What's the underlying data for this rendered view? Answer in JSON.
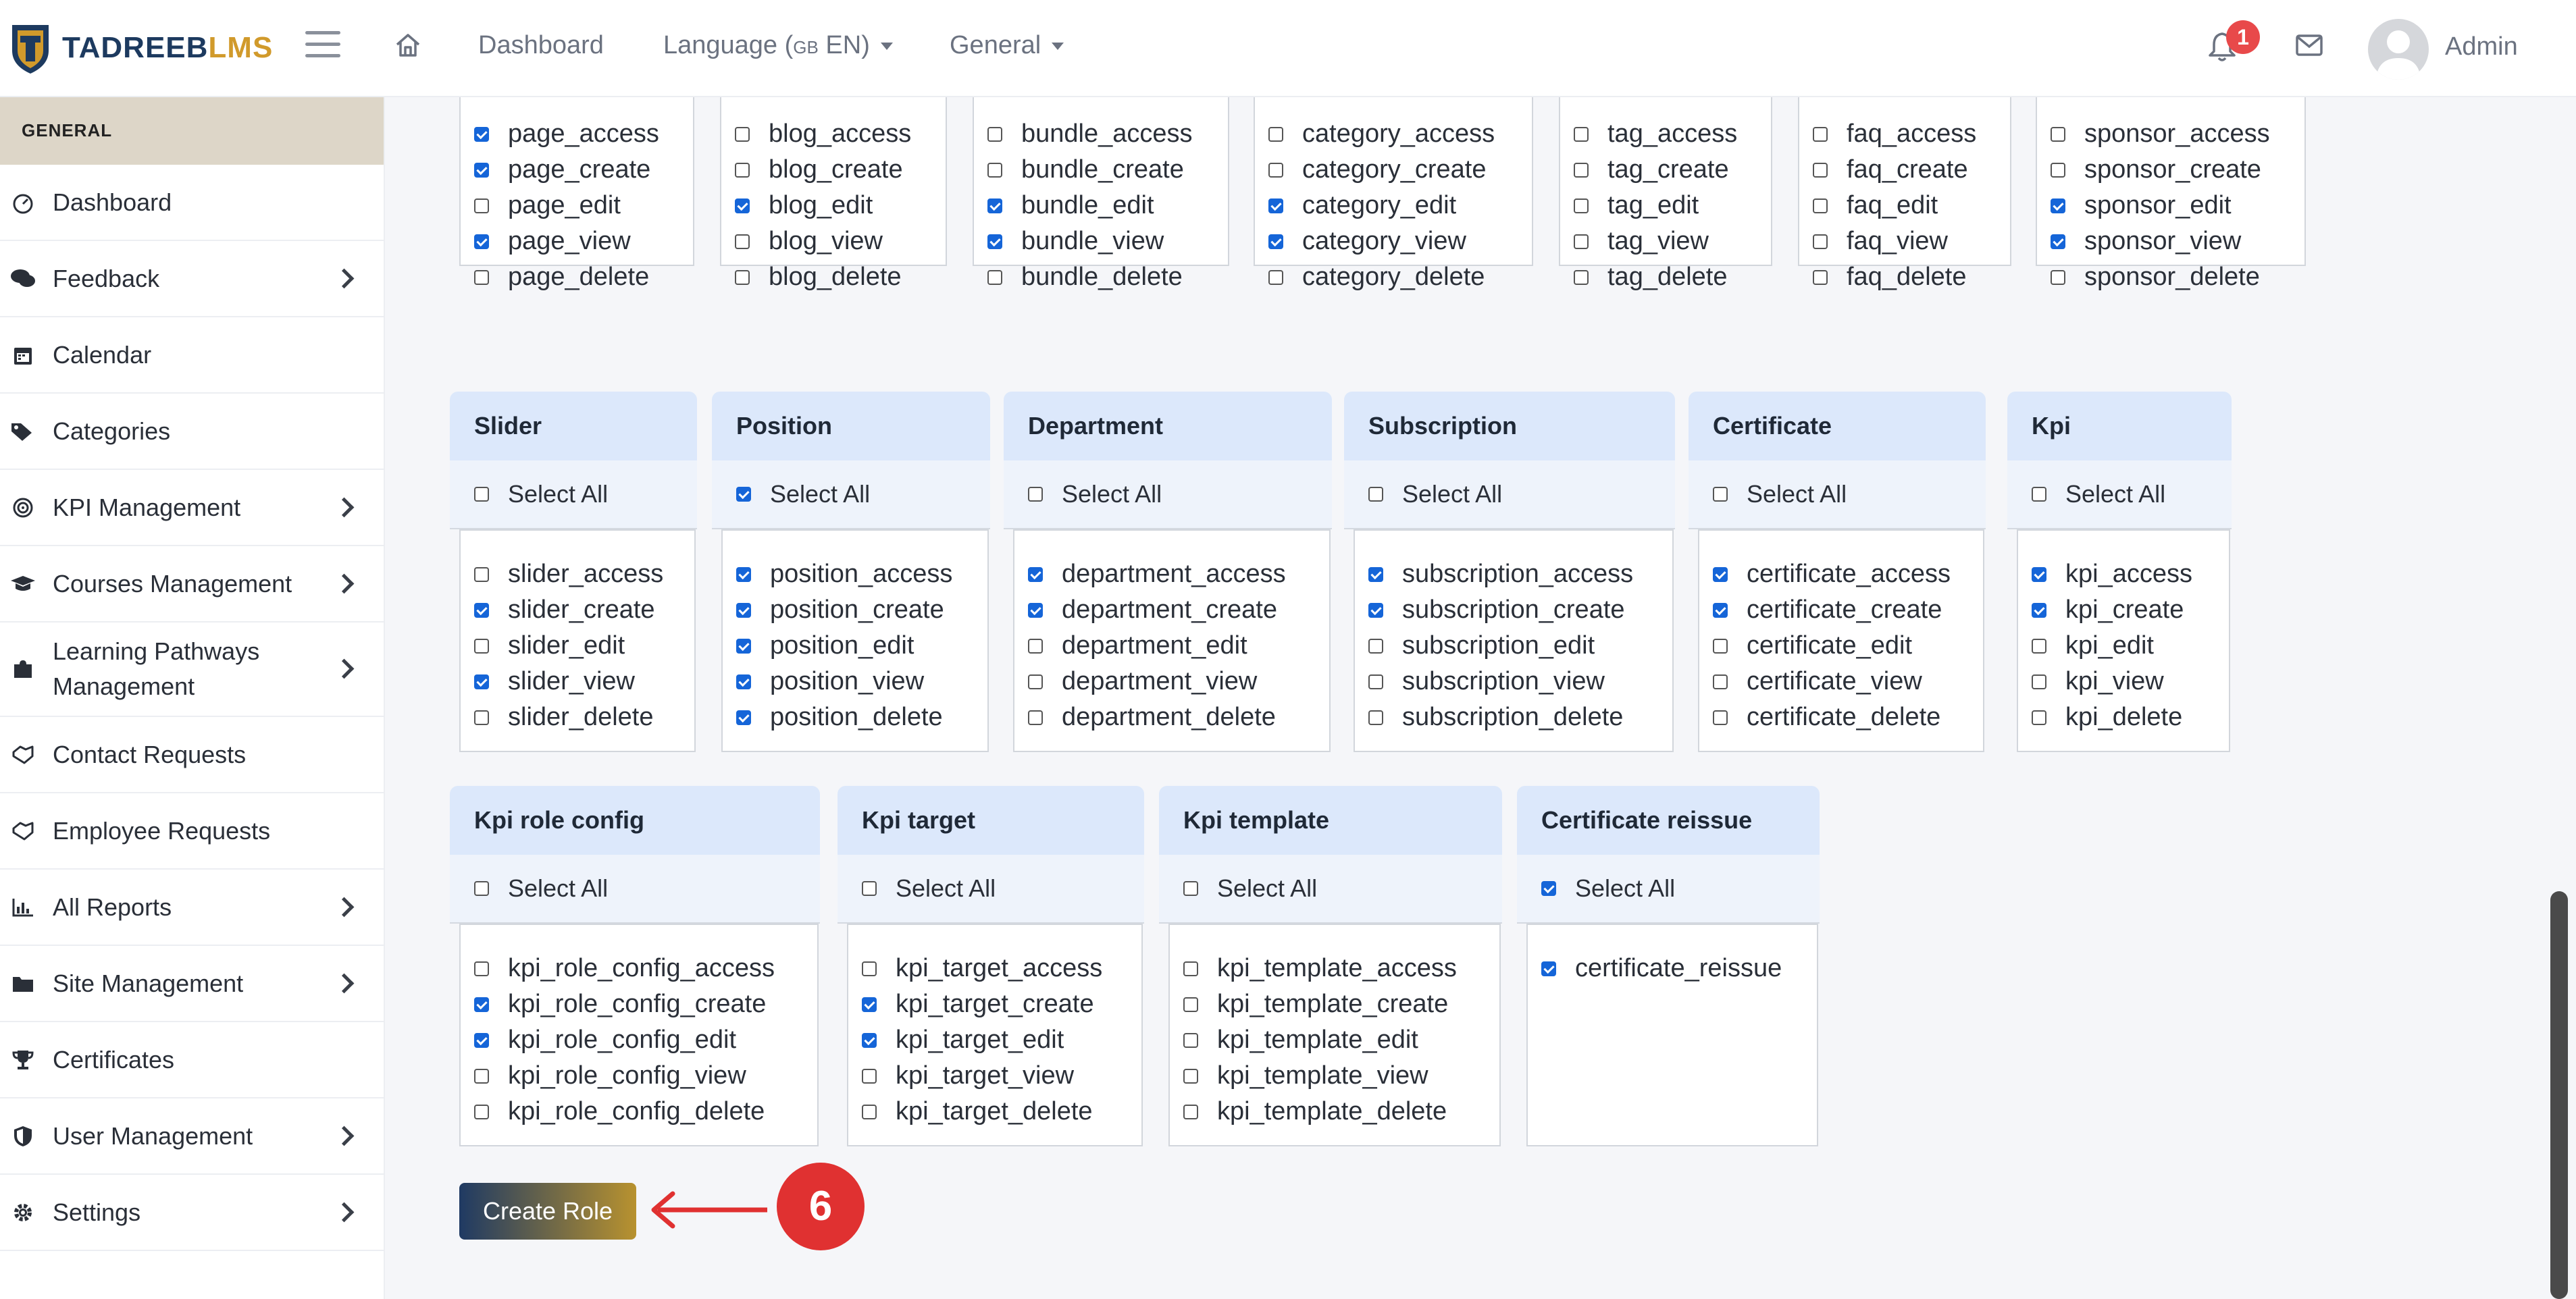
{
  "brand": {
    "name_part1": "TADREEB",
    "name_part2": "LMS",
    "colors": {
      "navy": "#1d3a5f",
      "gold": "#d19a2b"
    }
  },
  "topbar": {
    "nav": {
      "dashboard": "Dashboard",
      "language_label": "Language (",
      "language_flag": "GB",
      "language_code": " EN)",
      "general": "General"
    },
    "notifications_count": "1",
    "user_name": "Admin"
  },
  "sidebar": {
    "section_title": "GENERAL",
    "items": [
      {
        "label": "Dashboard",
        "icon": "dashboard-icon",
        "has_submenu": false
      },
      {
        "label": "Feedback",
        "icon": "comments-icon",
        "has_submenu": true
      },
      {
        "label": "Calendar",
        "icon": "calendar-icon",
        "has_submenu": false
      },
      {
        "label": "Categories",
        "icon": "tags-icon",
        "has_submenu": false
      },
      {
        "label": "KPI Management",
        "icon": "target-icon",
        "has_submenu": true
      },
      {
        "label": "Courses Management",
        "icon": "graduation-cap-icon",
        "has_submenu": true
      },
      {
        "label": "Learning Pathways Management",
        "icon": "puzzle-icon",
        "has_submenu": true
      },
      {
        "label": "Contact Requests",
        "icon": "handshake-icon",
        "has_submenu": false
      },
      {
        "label": "Employee Requests",
        "icon": "handshake-icon",
        "has_submenu": false
      },
      {
        "label": "All Reports",
        "icon": "bar-chart-icon",
        "has_submenu": true
      },
      {
        "label": "Site Management",
        "icon": "folder-icon",
        "has_submenu": true
      },
      {
        "label": "Certificates",
        "icon": "trophy-icon",
        "has_submenu": false
      },
      {
        "label": "User Management",
        "icon": "shield-icon",
        "has_submenu": true
      },
      {
        "label": "Settings",
        "icon": "gear-icon",
        "has_submenu": true
      }
    ]
  },
  "select_all_label": "Select All",
  "permission_groups": [
    {
      "title": "",
      "select_all": false,
      "perms": [
        {
          "name": "page_access",
          "checked": true
        },
        {
          "name": "page_create",
          "checked": true
        },
        {
          "name": "page_edit",
          "checked": false
        },
        {
          "name": "page_view",
          "checked": true
        },
        {
          "name": "page_delete",
          "checked": false
        }
      ]
    },
    {
      "title": "",
      "select_all": false,
      "perms": [
        {
          "name": "blog_access",
          "checked": false
        },
        {
          "name": "blog_create",
          "checked": false
        },
        {
          "name": "blog_edit",
          "checked": true
        },
        {
          "name": "blog_view",
          "checked": false
        },
        {
          "name": "blog_delete",
          "checked": false
        }
      ]
    },
    {
      "title": "",
      "select_all": false,
      "perms": [
        {
          "name": "bundle_access",
          "checked": false
        },
        {
          "name": "bundle_create",
          "checked": false
        },
        {
          "name": "bundle_edit",
          "checked": true
        },
        {
          "name": "bundle_view",
          "checked": true
        },
        {
          "name": "bundle_delete",
          "checked": false
        }
      ]
    },
    {
      "title": "",
      "select_all": false,
      "perms": [
        {
          "name": "category_access",
          "checked": false
        },
        {
          "name": "category_create",
          "checked": false
        },
        {
          "name": "category_edit",
          "checked": true
        },
        {
          "name": "category_view",
          "checked": true
        },
        {
          "name": "category_delete",
          "checked": false
        }
      ]
    },
    {
      "title": "",
      "select_all": false,
      "perms": [
        {
          "name": "tag_access",
          "checked": false
        },
        {
          "name": "tag_create",
          "checked": false
        },
        {
          "name": "tag_edit",
          "checked": false
        },
        {
          "name": "tag_view",
          "checked": false
        },
        {
          "name": "tag_delete",
          "checked": false
        }
      ]
    },
    {
      "title": "",
      "select_all": false,
      "perms": [
        {
          "name": "faq_access",
          "checked": false
        },
        {
          "name": "faq_create",
          "checked": false
        },
        {
          "name": "faq_edit",
          "checked": false
        },
        {
          "name": "faq_view",
          "checked": false
        },
        {
          "name": "faq_delete",
          "checked": false
        }
      ]
    },
    {
      "title": "",
      "select_all": false,
      "perms": [
        {
          "name": "sponsor_access",
          "checked": false
        },
        {
          "name": "sponsor_create",
          "checked": false
        },
        {
          "name": "sponsor_edit",
          "checked": true
        },
        {
          "name": "sponsor_view",
          "checked": true
        },
        {
          "name": "sponsor_delete",
          "checked": false
        }
      ]
    },
    {
      "title": "Slider",
      "select_all": false,
      "perms": [
        {
          "name": "slider_access",
          "checked": false
        },
        {
          "name": "slider_create",
          "checked": true
        },
        {
          "name": "slider_edit",
          "checked": false
        },
        {
          "name": "slider_view",
          "checked": true
        },
        {
          "name": "slider_delete",
          "checked": false
        }
      ]
    },
    {
      "title": "Position",
      "select_all": true,
      "perms": [
        {
          "name": "position_access",
          "checked": true
        },
        {
          "name": "position_create",
          "checked": true
        },
        {
          "name": "position_edit",
          "checked": true
        },
        {
          "name": "position_view",
          "checked": true
        },
        {
          "name": "position_delete",
          "checked": true
        }
      ]
    },
    {
      "title": "Department",
      "select_all": false,
      "perms": [
        {
          "name": "department_access",
          "checked": true
        },
        {
          "name": "department_create",
          "checked": true
        },
        {
          "name": "department_edit",
          "checked": false
        },
        {
          "name": "department_view",
          "checked": false
        },
        {
          "name": "department_delete",
          "checked": false
        }
      ]
    },
    {
      "title": "Subscription",
      "select_all": false,
      "perms": [
        {
          "name": "subscription_access",
          "checked": true
        },
        {
          "name": "subscription_create",
          "checked": true
        },
        {
          "name": "subscription_edit",
          "checked": false
        },
        {
          "name": "subscription_view",
          "checked": false
        },
        {
          "name": "subscription_delete",
          "checked": false
        }
      ]
    },
    {
      "title": "Certificate",
      "select_all": false,
      "perms": [
        {
          "name": "certificate_access",
          "checked": true
        },
        {
          "name": "certificate_create",
          "checked": true
        },
        {
          "name": "certificate_edit",
          "checked": false
        },
        {
          "name": "certificate_view",
          "checked": false
        },
        {
          "name": "certificate_delete",
          "checked": false
        }
      ]
    },
    {
      "title": "Kpi",
      "select_all": false,
      "perms": [
        {
          "name": "kpi_access",
          "checked": true
        },
        {
          "name": "kpi_create",
          "checked": true
        },
        {
          "name": "kpi_edit",
          "checked": false
        },
        {
          "name": "kpi_view",
          "checked": false
        },
        {
          "name": "kpi_delete",
          "checked": false
        }
      ]
    },
    {
      "title": "Kpi role config",
      "select_all": false,
      "perms": [
        {
          "name": "kpi_role_config_access",
          "checked": false
        },
        {
          "name": "kpi_role_config_create",
          "checked": true
        },
        {
          "name": "kpi_role_config_edit",
          "checked": true
        },
        {
          "name": "kpi_role_config_view",
          "checked": false
        },
        {
          "name": "kpi_role_config_delete",
          "checked": false
        }
      ]
    },
    {
      "title": "Kpi target",
      "select_all": false,
      "perms": [
        {
          "name": "kpi_target_access",
          "checked": false
        },
        {
          "name": "kpi_target_create",
          "checked": true
        },
        {
          "name": "kpi_target_edit",
          "checked": true
        },
        {
          "name": "kpi_target_view",
          "checked": false
        },
        {
          "name": "kpi_target_delete",
          "checked": false
        }
      ]
    },
    {
      "title": "Kpi template",
      "select_all": false,
      "perms": [
        {
          "name": "kpi_template_access",
          "checked": false
        },
        {
          "name": "kpi_template_create",
          "checked": false
        },
        {
          "name": "kpi_template_edit",
          "checked": false
        },
        {
          "name": "kpi_template_view",
          "checked": false
        },
        {
          "name": "kpi_template_delete",
          "checked": false
        }
      ]
    },
    {
      "title": "Certificate reissue",
      "select_all": true,
      "perms": [
        {
          "name": "certificate_reissue",
          "checked": true
        }
      ]
    }
  ],
  "create_button_label": "Create Role",
  "callout": {
    "step_number": "6",
    "color": "#e03131"
  },
  "colors": {
    "checkbox_checked": "#1565d8",
    "card_header": "#dce8fb",
    "sidebar_header": "#ddd6c8"
  }
}
